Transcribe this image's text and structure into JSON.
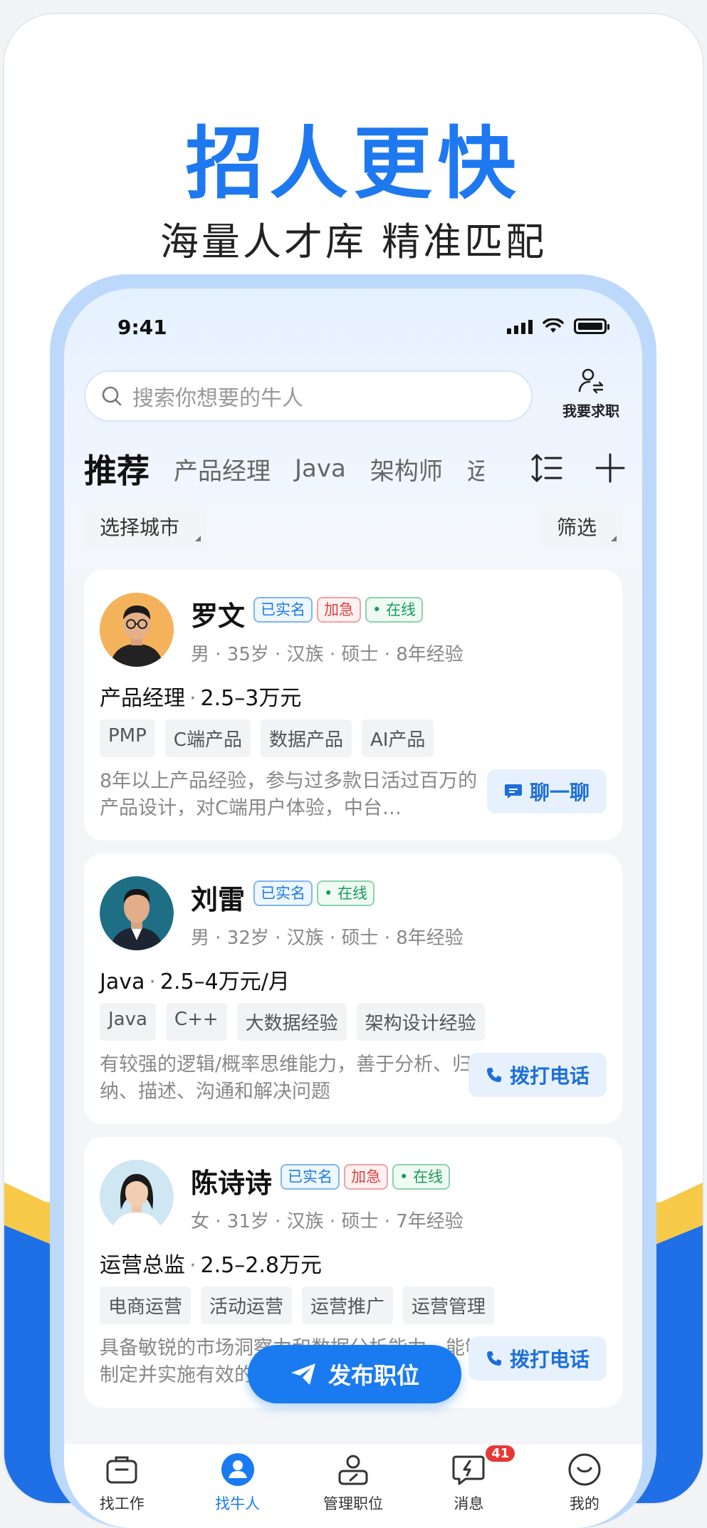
{
  "headline": "招人更快",
  "subline": "海量人才库 精准匹配",
  "status": {
    "time": "9:41"
  },
  "search": {
    "placeholder": "搜索你想要的牛人"
  },
  "seek_job": {
    "label": "我要求职"
  },
  "tabs": [
    "推荐",
    "产品经理",
    "Java",
    "架构师",
    "运"
  ],
  "filters": {
    "city": "选择城市",
    "filter": "筛选"
  },
  "candidates": [
    {
      "name": "罗文",
      "badges": [
        "已实名",
        "加急",
        "在线"
      ],
      "meta": "男 · 35岁 · 汉族 · 硕士 · 8年经验",
      "position": "产品经理",
      "salary": "2.5–3万元",
      "tags": [
        "PMP",
        "C端产品",
        "数据产品",
        "AI产品"
      ],
      "desc": "8年以上产品经验，参与过多款日活过百万的产品设计，对C端用户体验，中台…",
      "action": "聊一聊",
      "action_icon": "chat-icon"
    },
    {
      "name": "刘雷",
      "badges": [
        "已实名",
        "在线"
      ],
      "meta": "男 · 32岁 · 汉族 · 硕士 · 8年经验",
      "position": "Java",
      "salary": "2.5–4万元/月",
      "tags": [
        "Java",
        "C++",
        "大数据经验",
        "架构设计经验"
      ],
      "desc": "有较强的逻辑/概率思维能力，善于分析、归纳、描述、沟通和解决问题",
      "action": "拨打电话",
      "action_icon": "phone-icon"
    },
    {
      "name": "陈诗诗",
      "badges": [
        "已实名",
        "加急",
        "在线"
      ],
      "meta": "女 · 31岁 · 汉族 · 硕士 · 7年经验",
      "position": "运营总监",
      "salary": "2.5–2.8万元",
      "tags": [
        "电商运营",
        "活动运营",
        "运营推广",
        "运营管理"
      ],
      "desc": "具备敏锐的市场洞察力和数据分析能力，能够制定并实施有效的运营策略",
      "action": "拨打电话",
      "action_icon": "phone-icon"
    }
  ],
  "publish": {
    "label": "发布职位"
  },
  "tabbar": [
    {
      "label": "找工作",
      "icon": "briefcase-icon"
    },
    {
      "label": "找牛人",
      "icon": "person-icon"
    },
    {
      "label": "管理职位",
      "icon": "manage-icon"
    },
    {
      "label": "消息",
      "icon": "message-icon",
      "badge": "41"
    },
    {
      "label": "我的",
      "icon": "smile-icon"
    }
  ],
  "colors": {
    "accent": "#1a7af0",
    "headline": "#1e78f0",
    "urgent": "#d94040",
    "online": "#1a9d58"
  }
}
